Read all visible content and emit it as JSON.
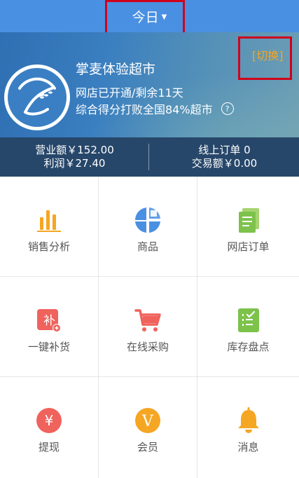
{
  "topbar": {
    "period_label": "今日"
  },
  "store": {
    "name": "掌麦体验超市",
    "status": "网店已开通/剩余11天",
    "score_text": "综合得分打败全国84%超市",
    "switch_label": "[切换]"
  },
  "stats": {
    "revenue": "营业额￥152.00",
    "profit": "利润￥27.40",
    "online_orders": "线上订单 0",
    "transaction_amount": "交易额￥0.00"
  },
  "grid": {
    "items": [
      {
        "label": "销售分析",
        "icon": "bar-chart-icon"
      },
      {
        "label": "商品",
        "icon": "goods-grid-icon"
      },
      {
        "label": "网店订单",
        "icon": "order-document-icon"
      },
      {
        "label": "一键补货",
        "icon": "restock-icon"
      },
      {
        "label": "在线采购",
        "icon": "shopping-cart-icon"
      },
      {
        "label": "库存盘点",
        "icon": "inventory-checklist-icon"
      },
      {
        "label": "提现",
        "icon": "withdraw-yuan-icon"
      },
      {
        "label": "会员",
        "icon": "member-v-icon"
      },
      {
        "label": "消息",
        "icon": "bell-icon"
      }
    ]
  },
  "colors": {
    "topbar": "#4a90e2",
    "switch": "#f5a623",
    "highlight_box": "#d0021b"
  }
}
